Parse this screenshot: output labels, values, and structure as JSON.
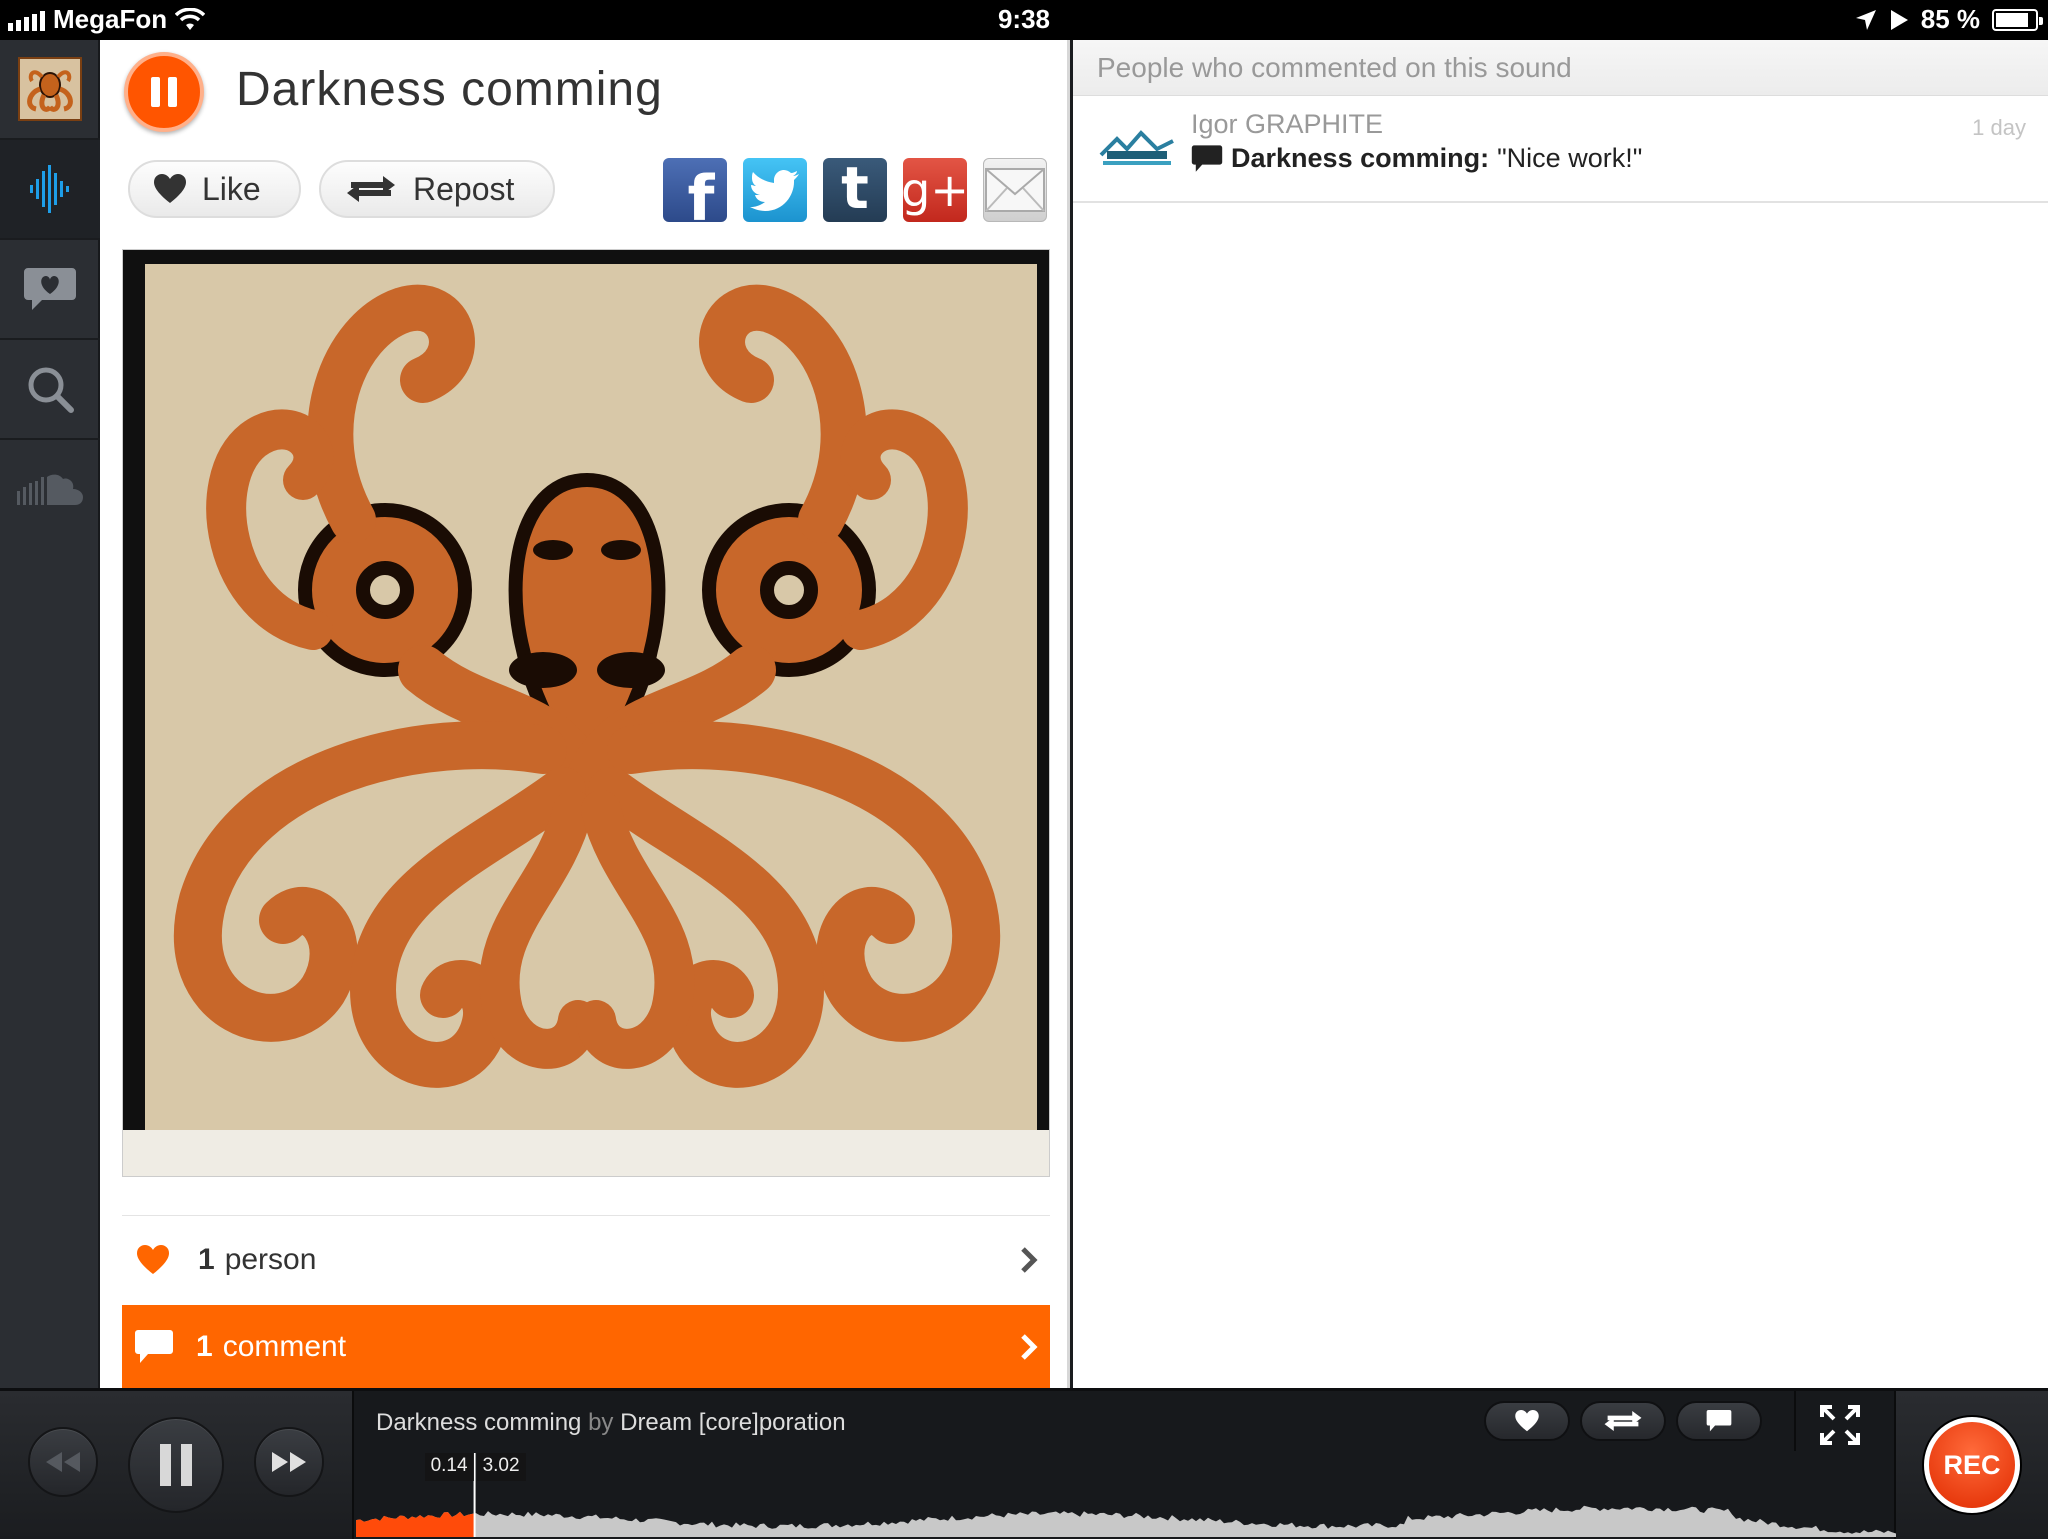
{
  "status": {
    "carrier": "MegaFon",
    "time": "9:38",
    "battery": "85 %",
    "battery_level": 0.85
  },
  "sidebar": {
    "items": [
      {
        "name": "profile-avatar",
        "active": false
      },
      {
        "name": "stream-icon",
        "active": true
      },
      {
        "name": "activity-icon",
        "active": false
      },
      {
        "name": "search-icon",
        "active": false
      },
      {
        "name": "soundcloud-icon",
        "active": false
      }
    ]
  },
  "sound": {
    "title": "Darkness comming",
    "like_label": "Like",
    "repost_label": "Repost",
    "likes_count": "1",
    "likes_unit": "person",
    "comments_count": "1",
    "comments_unit": "comment"
  },
  "share": {
    "facebook": "f",
    "twitter": "t",
    "tumblr": "t",
    "googleplus": "g+"
  },
  "comments": {
    "header": "People who commented on this sound",
    "items": [
      {
        "user": "Igor GRAPHITE",
        "time": "1 day",
        "track": "Darkness comming:",
        "text": "\"Nice work!\""
      }
    ]
  },
  "player": {
    "track": "Darkness comming",
    "by": "by",
    "artist": "Dream [core]poration",
    "elapsed": "0.14",
    "duration": "3.02",
    "progress": 0.077,
    "rec_label": "REC"
  },
  "colors": {
    "accent": "#ff5500",
    "comment_bar": "#ff6600",
    "facebook": "#3b5998",
    "twitter": "#2aa9e0",
    "tumblr": "#2c4762",
    "googleplus": "#d73d32"
  }
}
